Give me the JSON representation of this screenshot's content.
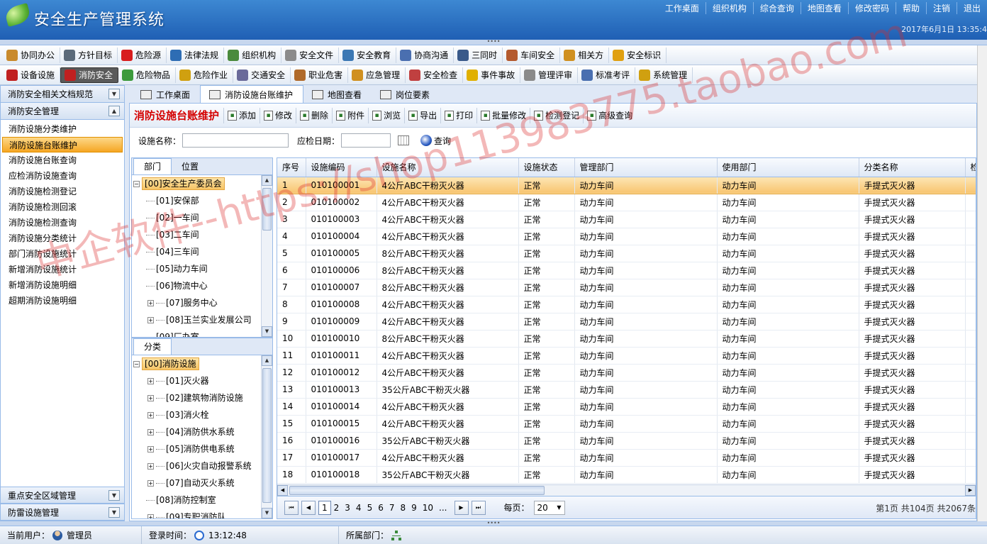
{
  "app": {
    "title": "安全生产管理系统",
    "date": "2017年6月1日  13:35:4"
  },
  "top_links": [
    "工作桌面",
    "组织机构",
    "综合查询",
    "地图查看",
    "修改密码",
    "帮助",
    "注销",
    "退出"
  ],
  "modules_row1": [
    {
      "label": "协同办公",
      "icon": "handshake-icon",
      "color": "#c98a2c"
    },
    {
      "label": "方针目标",
      "icon": "target-icon",
      "color": "#5b6a7a"
    },
    {
      "label": "危险源",
      "icon": "red-dot-icon",
      "color": "#d81e1e"
    },
    {
      "label": "法律法规",
      "icon": "book-icon",
      "color": "#2e6db4"
    },
    {
      "label": "组织机构",
      "icon": "org-chart-icon",
      "color": "#4a8a3c"
    },
    {
      "label": "安全文件",
      "icon": "document-icon",
      "color": "#8b8b8b"
    },
    {
      "label": "安全教育",
      "icon": "speech-icon",
      "color": "#3c78b4"
    },
    {
      "label": "协商沟通",
      "icon": "mail-icon",
      "color": "#4a6fb0"
    },
    {
      "label": "三同时",
      "icon": "list-icon",
      "color": "#3a5a8a"
    },
    {
      "label": "车间安全",
      "icon": "worker-icon",
      "color": "#b45a2e"
    },
    {
      "label": "相关方",
      "icon": "partner-icon",
      "color": "#d09020"
    },
    {
      "label": "安全标识",
      "icon": "flag-icon",
      "color": "#e0a010"
    }
  ],
  "modules_row2": [
    {
      "label": "设备设施",
      "icon": "device-icon",
      "color": "#c02020"
    },
    {
      "label": "消防安全",
      "icon": "fire-icon",
      "color": "#c02020",
      "active": true
    },
    {
      "label": "危险物品",
      "icon": "flask-icon",
      "color": "#3c9a3c"
    },
    {
      "label": "危险作业",
      "icon": "hazard-icon",
      "color": "#d0a010"
    },
    {
      "label": "交通安全",
      "icon": "truck-icon",
      "color": "#6a6a9a"
    },
    {
      "label": "职业危害",
      "icon": "people-icon",
      "color": "#b06a2a"
    },
    {
      "label": "应急管理",
      "icon": "emergency-icon",
      "color": "#d09020"
    },
    {
      "label": "安全检查",
      "icon": "magnifier-icon",
      "color": "#c04040"
    },
    {
      "label": "事件事故",
      "icon": "warning-icon",
      "color": "#e0b000"
    },
    {
      "label": "管理评审",
      "icon": "review-icon",
      "color": "#8a8a8a"
    },
    {
      "label": "标准考评",
      "icon": "edit-icon",
      "color": "#4a6fb0"
    },
    {
      "label": "系统管理",
      "icon": "lock-icon",
      "color": "#d0a010"
    }
  ],
  "leftnav": {
    "top_head": "消防安全相关文档规范",
    "section_head": "消防安全管理",
    "items": [
      "消防设施分类维护",
      "消防设施台账维护",
      "消防设施台账查询",
      "应检消防设施查询",
      "消防设施检测登记",
      "消防设施检测回滚",
      "消防设施检测查询",
      "消防设施分类统计",
      "部门消防设施统计",
      "新增消防设施统计",
      "新增消防设施明细",
      "超期消防设施明细"
    ],
    "selected_index": 1,
    "bottom_heads": [
      "重点安全区域管理",
      "防雷设施管理"
    ]
  },
  "tabs": [
    {
      "label": "工作桌面",
      "icon": "desktop-icon"
    },
    {
      "label": "消防设施台账维护",
      "icon": "ledger-icon",
      "active": true
    },
    {
      "label": "地图查看",
      "icon": "map-icon"
    },
    {
      "label": "岗位要素",
      "icon": "list-icon"
    }
  ],
  "toolbar": {
    "heading": "消防设施台账维护",
    "buttons": [
      {
        "label": "添加",
        "icon": "add-icon"
      },
      {
        "label": "修改",
        "icon": "edit-icon"
      },
      {
        "label": "删除",
        "icon": "delete-icon"
      },
      {
        "label": "附件",
        "icon": "attachment-icon"
      },
      {
        "label": "浏览",
        "icon": "browse-icon"
      },
      {
        "label": "导出",
        "icon": "export-icon"
      },
      {
        "label": "打印",
        "icon": "print-icon"
      },
      {
        "label": "批量修改",
        "icon": "batch-edit-icon"
      },
      {
        "label": "检测登记",
        "icon": "register-icon"
      },
      {
        "label": "高级查询",
        "icon": "advanced-search-icon"
      }
    ]
  },
  "filter": {
    "name_label": "设施名称：",
    "name_value": "",
    "date_label": "应检日期：",
    "date_value": "",
    "query_label": "查询"
  },
  "dept_panel": {
    "tabs": [
      "部门",
      "位置"
    ],
    "nodes": [
      {
        "label": "[00]安全生产委员会",
        "level": 0,
        "root": true,
        "expander": "−"
      },
      {
        "label": "[01]安保部",
        "level": 1
      },
      {
        "label": "[02]一车间",
        "level": 1
      },
      {
        "label": "[03]二车间",
        "level": 1
      },
      {
        "label": "[04]三车间",
        "level": 1
      },
      {
        "label": "[05]动力车间",
        "level": 1
      },
      {
        "label": "[06]物流中心",
        "level": 1
      },
      {
        "label": "[07]服务中心",
        "level": 1,
        "expander": "+"
      },
      {
        "label": "[08]玉兰实业发展公司",
        "level": 1,
        "expander": "+"
      },
      {
        "label": "[09]厂办室",
        "level": 1
      }
    ]
  },
  "cat_panel": {
    "tabs": [
      "分类"
    ],
    "nodes": [
      {
        "label": "[00]消防设施",
        "level": 0,
        "root": true,
        "expander": "−"
      },
      {
        "label": "[01]灭火器",
        "level": 1,
        "expander": "+"
      },
      {
        "label": "[02]建筑物消防设施",
        "level": 1,
        "expander": "+"
      },
      {
        "label": "[03]消火栓",
        "level": 1,
        "expander": "+"
      },
      {
        "label": "[04]消防供水系统",
        "level": 1,
        "expander": "+"
      },
      {
        "label": "[05]消防供电系统",
        "level": 1,
        "expander": "+"
      },
      {
        "label": "[06]火灾自动报警系统",
        "level": 1,
        "expander": "+"
      },
      {
        "label": "[07]自动灭火系统",
        "level": 1,
        "expander": "+"
      },
      {
        "label": "[08]消防控制室",
        "level": 1
      },
      {
        "label": "[09]专职消防队",
        "level": 1,
        "expander": "+"
      }
    ]
  },
  "grid": {
    "columns": [
      "序号",
      "设施编码",
      "设施名称",
      "设施状态",
      "管理部门",
      "使用部门",
      "分类名称",
      "检"
    ],
    "selected_row": 0,
    "rows": [
      [
        "1",
        "010100001",
        "4公斤ABC干粉灭火器",
        "正常",
        "动力车间",
        "动力车间",
        "手提式灭火器"
      ],
      [
        "2",
        "010100002",
        "4公斤ABC干粉灭火器",
        "正常",
        "动力车间",
        "动力车间",
        "手提式灭火器"
      ],
      [
        "3",
        "010100003",
        "4公斤ABC干粉灭火器",
        "正常",
        "动力车间",
        "动力车间",
        "手提式灭火器"
      ],
      [
        "4",
        "010100004",
        "4公斤ABC干粉灭火器",
        "正常",
        "动力车间",
        "动力车间",
        "手提式灭火器"
      ],
      [
        "5",
        "010100005",
        "8公斤ABC干粉灭火器",
        "正常",
        "动力车间",
        "动力车间",
        "手提式灭火器"
      ],
      [
        "6",
        "010100006",
        "8公斤ABC干粉灭火器",
        "正常",
        "动力车间",
        "动力车间",
        "手提式灭火器"
      ],
      [
        "7",
        "010100007",
        "8公斤ABC干粉灭火器",
        "正常",
        "动力车间",
        "动力车间",
        "手提式灭火器"
      ],
      [
        "8",
        "010100008",
        "4公斤ABC干粉灭火器",
        "正常",
        "动力车间",
        "动力车间",
        "手提式灭火器"
      ],
      [
        "9",
        "010100009",
        "4公斤ABC干粉灭火器",
        "正常",
        "动力车间",
        "动力车间",
        "手提式灭火器"
      ],
      [
        "10",
        "010100010",
        "8公斤ABC干粉灭火器",
        "正常",
        "动力车间",
        "动力车间",
        "手提式灭火器"
      ],
      [
        "11",
        "010100011",
        "4公斤ABC干粉灭火器",
        "正常",
        "动力车间",
        "动力车间",
        "手提式灭火器"
      ],
      [
        "12",
        "010100012",
        "4公斤ABC干粉灭火器",
        "正常",
        "动力车间",
        "动力车间",
        "手提式灭火器"
      ],
      [
        "13",
        "010100013",
        "35公斤ABC干粉灭火器",
        "正常",
        "动力车间",
        "动力车间",
        "手提式灭火器"
      ],
      [
        "14",
        "010100014",
        "4公斤ABC干粉灭火器",
        "正常",
        "动力车间",
        "动力车间",
        "手提式灭火器"
      ],
      [
        "15",
        "010100015",
        "4公斤ABC干粉灭火器",
        "正常",
        "动力车间",
        "动力车间",
        "手提式灭火器"
      ],
      [
        "16",
        "010100016",
        "35公斤ABC干粉灭火器",
        "正常",
        "动力车间",
        "动力车间",
        "手提式灭火器"
      ],
      [
        "17",
        "010100017",
        "4公斤ABC干粉灭火器",
        "正常",
        "动力车间",
        "动力车间",
        "手提式灭火器"
      ],
      [
        "18",
        "010100018",
        "35公斤ABC干粉灭火器",
        "正常",
        "动力车间",
        "动力车间",
        "手提式灭火器"
      ]
    ]
  },
  "pager": {
    "pages": [
      "1",
      "2",
      "3",
      "4",
      "5",
      "6",
      "7",
      "8",
      "9",
      "10",
      "..."
    ],
    "current": "1",
    "size_label": "每页：",
    "page_size": "20",
    "info": "第1页 共104页 共2067条"
  },
  "status": {
    "user_label": "当前用户：",
    "user": "管理员",
    "login_label": "登录时间：",
    "login_time": "13:12:48",
    "dept_label": "所属部门："
  },
  "watermark": "中企软件--https://shop113983775.taobao.com"
}
